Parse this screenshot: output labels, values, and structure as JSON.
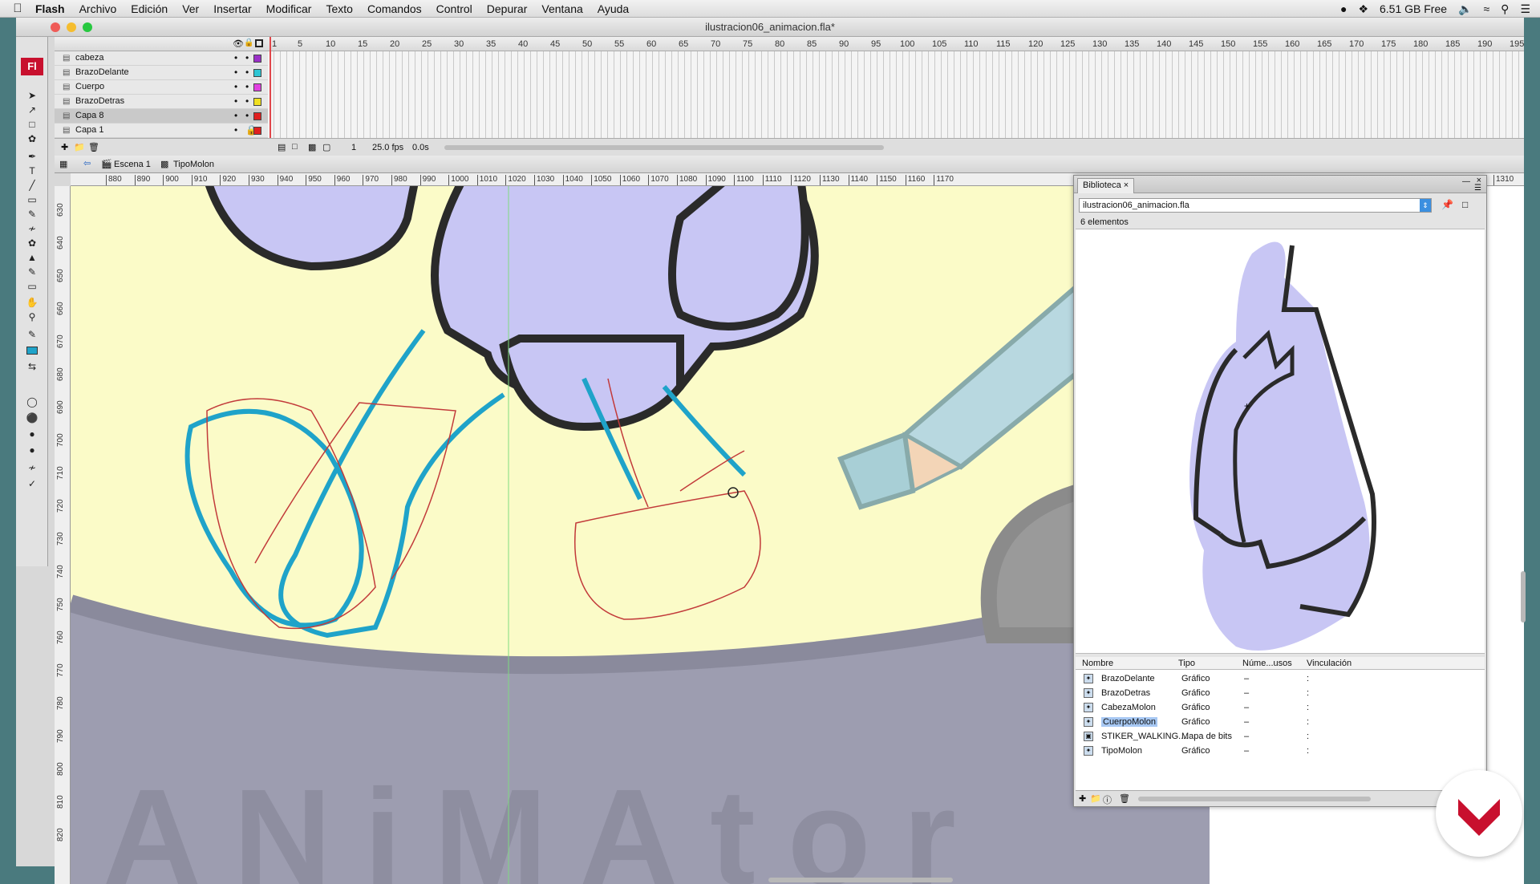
{
  "menubar": {
    "app_name": "Flash",
    "items": [
      "Archivo",
      "Edición",
      "Ver",
      "Insertar",
      "Modificar",
      "Texto",
      "Comandos",
      "Control",
      "Depurar",
      "Ventana",
      "Ayuda"
    ],
    "free_space": "6.51 GB Free"
  },
  "window": {
    "title": "ilustracion06_animacion.fla*"
  },
  "timeline": {
    "frame_numbers": [
      "1",
      "5",
      "10",
      "15",
      "20",
      "25",
      "30",
      "35",
      "40",
      "45",
      "50",
      "55",
      "60",
      "65",
      "70",
      "75",
      "80",
      "85",
      "90",
      "95",
      "100",
      "105",
      "110",
      "115",
      "120",
      "125",
      "130",
      "135",
      "140",
      "145",
      "150",
      "155",
      "160",
      "165",
      "170",
      "175",
      "180",
      "185",
      "190",
      "195"
    ],
    "layers": [
      {
        "name": "cabeza",
        "color": "#9b30c8"
      },
      {
        "name": "BrazoDelante",
        "color": "#2ec6d4"
      },
      {
        "name": "Cuerpo",
        "color": "#e040e0"
      },
      {
        "name": "BrazoDetras",
        "color": "#f0e020"
      },
      {
        "name": "Capa 8",
        "color": "#e02020",
        "selected": true
      },
      {
        "name": "Capa 1",
        "color": "#e02020",
        "locked": true
      }
    ],
    "current_frame": "1",
    "fps": "25.0 fps",
    "time": "0.0s"
  },
  "editbar": {
    "scene": "Escena 1",
    "symbol": "TipoMolon"
  },
  "ruler": {
    "top_labels": [
      "880",
      "890",
      "900",
      "910",
      "920",
      "930",
      "940",
      "950",
      "960",
      "970",
      "980",
      "990",
      "1000",
      "1010",
      "1020",
      "1030",
      "1040",
      "1050",
      "1060",
      "1070",
      "1080",
      "1090",
      "1100",
      "1110",
      "1120",
      "1130",
      "1140",
      "1150",
      "1160",
      "1170",
      "1310"
    ],
    "left_labels": [
      "630",
      "640",
      "650",
      "660",
      "670",
      "680",
      "690",
      "700",
      "710",
      "720",
      "730",
      "740",
      "750",
      "760",
      "770",
      "780",
      "790",
      "800",
      "810",
      "820"
    ]
  },
  "library": {
    "tab_label": "Biblioteca",
    "file": "ilustracion06_animacion.fla",
    "count": "6 elementos",
    "columns": [
      "Nombre",
      "Tipo",
      "Núme...usos",
      "Vinculación"
    ],
    "items": [
      {
        "name": "BrazoDelante",
        "type": "Gráfico",
        "uses": "–",
        "link": ":"
      },
      {
        "name": "BrazoDetras",
        "type": "Gráfico",
        "uses": "–",
        "link": ":"
      },
      {
        "name": "CabezaMolon",
        "type": "Gráfico",
        "uses": "–",
        "link": ":"
      },
      {
        "name": "CuerpoMolon",
        "type": "Gráfico",
        "uses": "–",
        "link": ":",
        "selected": true
      },
      {
        "name": "STIKER_WALKING....",
        "type": "Mapa de bits",
        "uses": "–",
        "link": ":"
      },
      {
        "name": "TipoMolon",
        "type": "Gráfico",
        "uses": "–",
        "link": ":"
      }
    ]
  },
  "colors": {
    "body_fill": "#c8c6f4",
    "outline": "#2a2a2a",
    "sketch_blue": "#1fa3c9",
    "sketch_red": "#c23a3a",
    "background_yellow": "#fbfbc8",
    "banner_gray": "#9d9db0"
  },
  "icons": [
    "apple-icon",
    "search-icon",
    "menu-list-icon",
    "wifi-icon",
    "volume-icon",
    "dropbox-icon"
  ]
}
